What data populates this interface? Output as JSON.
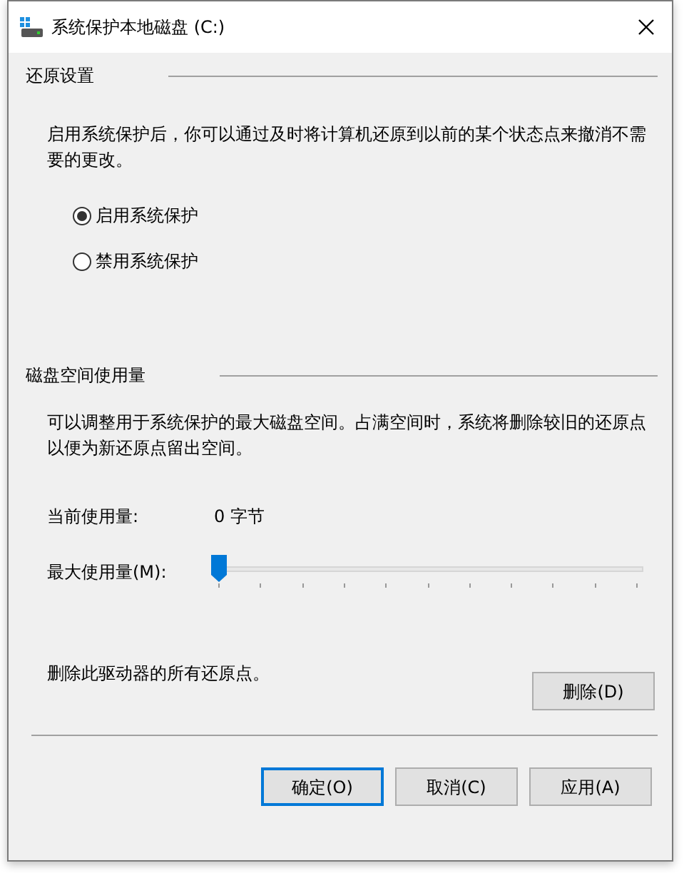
{
  "window": {
    "title": "系统保护本地磁盘 (C:)"
  },
  "restore_settings": {
    "heading": "还原设置",
    "description": "启用系统保护后，你可以通过及时将计算机还原到以前的某个状态点来撤消不需要的更改。",
    "options": [
      {
        "label": "启用系统保护",
        "selected": true
      },
      {
        "label": "禁用系统保护",
        "selected": false
      }
    ]
  },
  "disk_usage": {
    "heading": "磁盘空间使用量",
    "description": "可以调整用于系统保护的最大磁盘空间。占满空间时，系统将删除较旧的还原点以便为新还原点留出空间。",
    "current_label": "当前使用量:",
    "current_value": "0 字节",
    "max_label": "最大使用量(M):",
    "max_slider": {
      "level": 0
    },
    "delete_text": "删除此驱动器的所有还原点。",
    "delete_button": "删除(D)"
  },
  "buttons": [
    {
      "label": "确定(O)",
      "selected": true
    },
    {
      "label": "取消(C)",
      "selected": false
    },
    {
      "label": "应用(A)",
      "selected": false
    }
  ]
}
